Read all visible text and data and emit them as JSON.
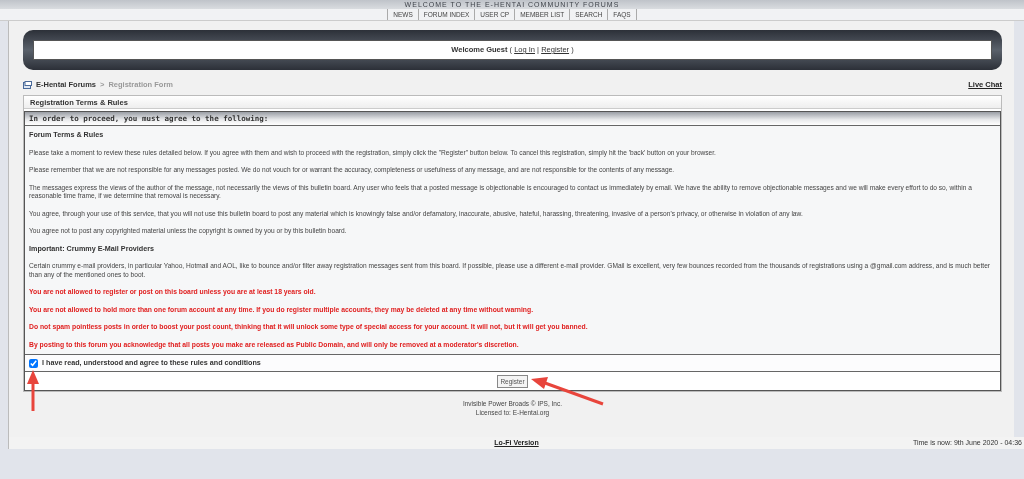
{
  "banner": {
    "title": "WELCOME TO THE E-HENTAI COMMUNITY FORUMS"
  },
  "nav": [
    {
      "label": "NEWS"
    },
    {
      "label": "FORUM INDEX"
    },
    {
      "label": "USER CP"
    },
    {
      "label": "MEMBER LIST"
    },
    {
      "label": "SEARCH"
    },
    {
      "label": "FAQS"
    }
  ],
  "welcome": {
    "greeting": "Welcome Guest",
    "open": "(",
    "links": [
      "Log In",
      "Register"
    ],
    "separator": "|",
    "close": ")"
  },
  "breadcrumb": {
    "items": [
      "E-Hentai Forums",
      "Registration Form"
    ],
    "separator": ">",
    "live_chat": "Live Chat"
  },
  "terms": {
    "title": "Registration Terms & Rules",
    "intro": "In order to proceed, you must agree to the following:",
    "blocks": [
      {
        "kind": "heading",
        "text": "Forum Terms & Rules"
      },
      {
        "kind": "paragraph",
        "text": "Please take a moment to review these rules detailed below. If you agree with them and wish to proceed with the registration, simply click the \"Register\" button below. To cancel this registration, simply hit the 'back' button on your browser."
      },
      {
        "kind": "paragraph",
        "text": "Please remember that we are not responsible for any messages posted. We do not vouch for or warrant the accuracy, completeness or usefulness of any message, and are not responsible for the contents of any message."
      },
      {
        "kind": "paragraph",
        "text": "The messages express the views of the author of the message, not necessarily the views of this bulletin board. Any user who feels that a posted message is objectionable is encouraged to contact us immediately by email. We have the ability to remove objectionable messages and we will make every effort to do so, within a reasonable time frame, if we determine that removal is necessary."
      },
      {
        "kind": "paragraph",
        "text": "You agree, through your use of this service, that you will not use this bulletin board to post any material which is knowingly false and/or defamatory, inaccurate, abusive, hateful, harassing, threatening, invasive of a person's privacy, or otherwise in violation of any law."
      },
      {
        "kind": "paragraph",
        "text": "You agree not to post any copyrighted material unless the copyright is owned by you or by this bulletin board."
      },
      {
        "kind": "heading",
        "text": "Important: Crummy E-Mail Providers"
      },
      {
        "kind": "paragraph",
        "text": "Certain crummy e-mail providers, in particular Yahoo, Hotmail and AOL, like to bounce and/or filter away registration messages sent from this board. If possible, please use a different e-mail provider. GMail is excellent, very few bounces recorded from the thousands of registrations using a @gmail.com address, and is much better than any of the mentioned ones to boot."
      },
      {
        "kind": "warning",
        "text": "You are not allowed to register or post on this board unless you are at least 18 years old."
      },
      {
        "kind": "warning",
        "text": "You are not allowed to hold more than one forum account at any time. If you do register multiple accounts, they may be deleted at any time without warning."
      },
      {
        "kind": "warning",
        "text": "Do not spam pointless posts in order to boost your post count, thinking that it will unlock some type of special access for your account. It will not, but it will get you banned."
      },
      {
        "kind": "warning",
        "text": "By posting to this forum you acknowledge that all posts you make are released as Public Domain, and will only be removed at a moderator's discretion."
      }
    ],
    "agreement": {
      "label": "I have read, understood and agree to these rules and conditions",
      "checked": true
    },
    "register_button": "Register"
  },
  "footer": {
    "credit": "Invisible Power Broads © IPS, Inc.",
    "license": "Licensed to: E-Hentai.org"
  },
  "bottom_bar": {
    "lofi": "Lo-Fi Version",
    "time": "Time is now: 9th June 2020 - 04:36"
  }
}
